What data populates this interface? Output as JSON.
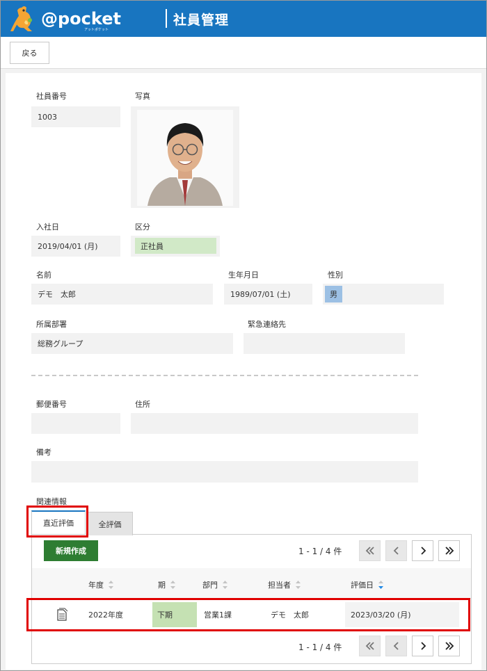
{
  "header": {
    "logo_text": "@pocket",
    "logo_sub": "アットポケット",
    "title": "社員管理",
    "brand_color": "#1875c0"
  },
  "toolbar": {
    "back_label": "戻る"
  },
  "fields": {
    "employee_no": {
      "label": "社員番号",
      "value": "1003"
    },
    "photo": {
      "label": "写真"
    },
    "join_date": {
      "label": "入社日",
      "value": "2019/04/01 (月)"
    },
    "category": {
      "label": "区分",
      "value": "正社員",
      "color": "#d1e9c7"
    },
    "name": {
      "label": "名前",
      "value": "デモ　太郎"
    },
    "birthday": {
      "label": "生年月日",
      "value": "1989/07/01 (土)"
    },
    "gender": {
      "label": "性別",
      "value": "男",
      "color": "#9cc0e4"
    },
    "department": {
      "label": "所属部署",
      "value": "総務グループ"
    },
    "emergency": {
      "label": "緊急連絡先",
      "value": ""
    },
    "postal": {
      "label": "郵便番号",
      "value": ""
    },
    "address": {
      "label": "住所",
      "value": ""
    },
    "notes": {
      "label": "備考",
      "value": ""
    }
  },
  "related": {
    "label": "関連情報",
    "tabs": [
      {
        "label": "直近評価",
        "active": true
      },
      {
        "label": "全評価",
        "active": false
      }
    ],
    "new_button": "新規作成",
    "pager": {
      "info": "1 - 1 / 4 件",
      "first": "«",
      "prev": "‹",
      "next": "›",
      "last": "»"
    },
    "columns": [
      "年度",
      "期",
      "部門",
      "担当者",
      "評価日"
    ],
    "rows": [
      {
        "year": "2022年度",
        "term": "下期",
        "dept": "営業1課",
        "person": "デモ　太郎",
        "date": "2023/03/20 (月)"
      }
    ]
  },
  "highlight_color": "#e00000"
}
